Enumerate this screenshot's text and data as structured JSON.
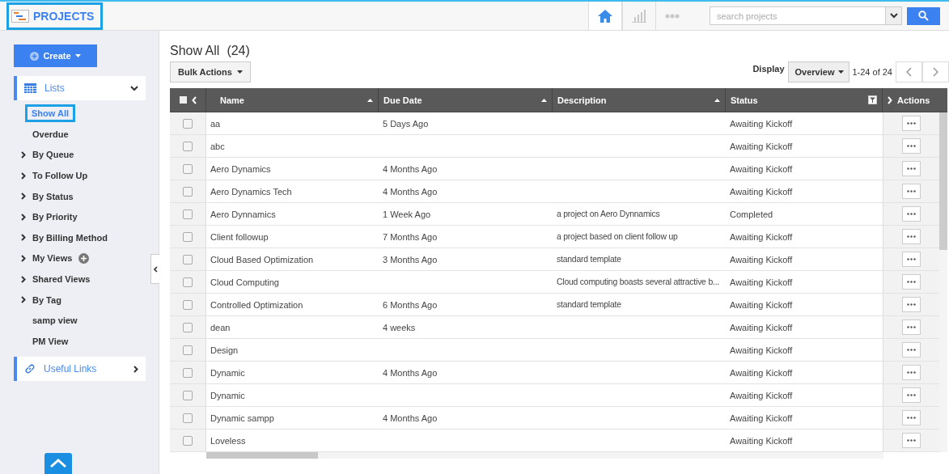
{
  "header": {
    "title": "PROJECTS",
    "nav": [
      {
        "kind": "home",
        "selected": true
      },
      {
        "kind": "chart",
        "selected": false
      },
      {
        "kind": "more",
        "selected": false
      }
    ],
    "search": {
      "placeholder": "search projects"
    }
  },
  "sidebar": {
    "create_label": "Create",
    "lists_label": "Lists",
    "items": [
      {
        "label": "Show All",
        "selected": true,
        "expandable": false,
        "addable": false
      },
      {
        "label": "Overdue",
        "selected": false,
        "expandable": false,
        "addable": false
      },
      {
        "label": "By Queue",
        "selected": false,
        "expandable": true,
        "addable": false
      },
      {
        "label": "To Follow Up",
        "selected": false,
        "expandable": true,
        "addable": false
      },
      {
        "label": "By Status",
        "selected": false,
        "expandable": true,
        "addable": false
      },
      {
        "label": "By Priority",
        "selected": false,
        "expandable": true,
        "addable": false
      },
      {
        "label": "By Billing Method",
        "selected": false,
        "expandable": true,
        "addable": false
      },
      {
        "label": "My Views",
        "selected": false,
        "expandable": true,
        "addable": true
      },
      {
        "label": "Shared Views",
        "selected": false,
        "expandable": true,
        "addable": false
      },
      {
        "label": "By Tag",
        "selected": false,
        "expandable": true,
        "addable": false
      },
      {
        "label": "samp view",
        "selected": false,
        "expandable": false,
        "addable": false
      },
      {
        "label": "PM View",
        "selected": false,
        "expandable": false,
        "addable": false
      }
    ],
    "links_label": "Useful Links"
  },
  "main": {
    "title": "Show All",
    "count": "(24)",
    "bulk_actions": "Bulk Actions",
    "display_label": "Display",
    "display_value": "Overview",
    "pagination": "1-24 of 24"
  },
  "table": {
    "select_all_checked": false,
    "columns": [
      {
        "label": "Name",
        "sortable": true,
        "filter": false
      },
      {
        "label": "Due Date",
        "sortable": true,
        "filter": false
      },
      {
        "label": "Description",
        "sortable": true,
        "filter": false
      },
      {
        "label": "Status",
        "sortable": false,
        "filter": true
      }
    ],
    "actions_label": "Actions",
    "rows": [
      {
        "checked": false,
        "cells": [
          "aa",
          "5 Days Ago",
          "",
          "Awaiting Kickoff"
        ]
      },
      {
        "checked": false,
        "cells": [
          "abc",
          "",
          "",
          "Awaiting Kickoff"
        ]
      },
      {
        "checked": false,
        "cells": [
          "Aero Dynamics",
          "4 Months Ago",
          "",
          "Awaiting Kickoff"
        ]
      },
      {
        "checked": false,
        "cells": [
          "Aero Dynamics Tech",
          "4 Months Ago",
          "",
          "Awaiting Kickoff"
        ]
      },
      {
        "checked": false,
        "cells": [
          "Aero Dynnamics",
          "1 Week Ago",
          "a project on Aero Dynnamics",
          "Completed"
        ]
      },
      {
        "checked": false,
        "cells": [
          "Client followup",
          "7 Months Ago",
          "a project based on client follow up",
          "Awaiting Kickoff"
        ]
      },
      {
        "checked": false,
        "cells": [
          "Cloud Based Optimization",
          "3 Months Ago",
          "standard template",
          "Awaiting Kickoff"
        ]
      },
      {
        "checked": false,
        "cells": [
          "Cloud Computing",
          "",
          "Cloud computing boasts several attractive b...",
          "Awaiting Kickoff"
        ]
      },
      {
        "checked": false,
        "cells": [
          "Controlled Optimization",
          "6 Months Ago",
          "standard template",
          "Awaiting Kickoff"
        ]
      },
      {
        "checked": false,
        "cells": [
          "dean",
          "4 weeks",
          "",
          "Awaiting Kickoff"
        ]
      },
      {
        "checked": false,
        "cells": [
          "Design",
          "",
          "",
          "Awaiting Kickoff"
        ]
      },
      {
        "checked": false,
        "cells": [
          "Dynamic",
          "4 Months Ago",
          "",
          "Awaiting Kickoff"
        ]
      },
      {
        "checked": false,
        "cells": [
          "Dynamic",
          "",
          "",
          "Awaiting Kickoff"
        ]
      },
      {
        "checked": false,
        "cells": [
          "Dynamic sampp",
          "4 Months Ago",
          "",
          "Awaiting Kickoff"
        ]
      },
      {
        "checked": false,
        "cells": [
          "Loveless",
          "",
          "",
          "Awaiting Kickoff"
        ]
      }
    ]
  }
}
